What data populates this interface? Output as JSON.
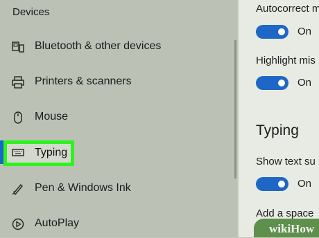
{
  "sidebar": {
    "section_title": "Devices",
    "items": [
      {
        "label": "Bluetooth & other devices",
        "icon": "bluetooth-devices-icon"
      },
      {
        "label": "Printers & scanners",
        "icon": "printer-icon"
      },
      {
        "label": "Mouse",
        "icon": "mouse-icon"
      },
      {
        "label": "Typing",
        "icon": "keyboard-icon",
        "active": true
      },
      {
        "label": "Pen & Windows Ink",
        "icon": "pen-icon"
      },
      {
        "label": "AutoPlay",
        "icon": "autoplay-icon"
      }
    ]
  },
  "content": {
    "autocorrect_label": "Autocorrect m",
    "autocorrect_state": "On",
    "highlight_label": "Highlight mis",
    "highlight_state": "On",
    "typing_heading": "Typing",
    "show_text_label": "Show text su",
    "show_text_state": "On",
    "add_space_label": "Add a space"
  },
  "watermark": "wikiHow",
  "colors": {
    "accent": "#1e67c6",
    "highlight": "#2ff21f",
    "sidebar_bg": "#bcc1b6",
    "content_bg": "#e8ebe4"
  }
}
